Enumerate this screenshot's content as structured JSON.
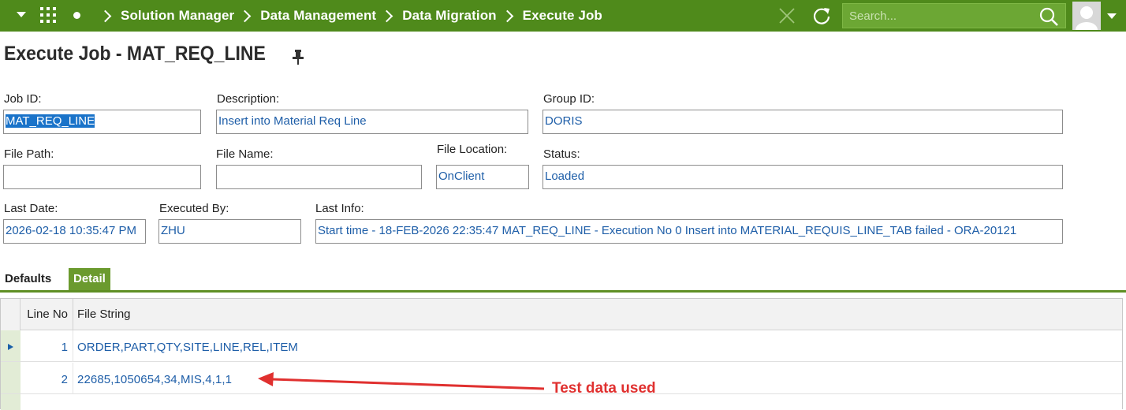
{
  "nav": {
    "breadcrumbs": [
      "Solution Manager",
      "Data Management",
      "Data Migration",
      "Execute Job"
    ],
    "search_placeholder": "Search...",
    "accent_color": "#4f8a1b"
  },
  "page": {
    "title": "Execute Job - MAT_REQ_LINE"
  },
  "form": {
    "job_id": {
      "label": "Job ID:",
      "value": "MAT_REQ_LINE"
    },
    "description": {
      "label": "Description:",
      "value": "Insert into Material Req Line"
    },
    "group_id": {
      "label": "Group ID:",
      "value": "DORIS"
    },
    "file_path": {
      "label": "File Path:",
      "value": ""
    },
    "file_name": {
      "label": "File Name:",
      "value": ""
    },
    "file_location": {
      "label": "File Location:",
      "value": "OnClient"
    },
    "status": {
      "label": "Status:",
      "value": "Loaded"
    },
    "last_date": {
      "label": "Last Date:",
      "value": "2026-02-18 10:35:47 PM"
    },
    "executed_by": {
      "label": "Executed By:",
      "value": "ZHU"
    },
    "last_info": {
      "label": "Last Info:",
      "value": "Start time - 18-FEB-2026 22:35:47   MAT_REQ_LINE - Execution No 0 Insert into MATERIAL_REQUIS_LINE_TAB failed - ORA-20121"
    }
  },
  "tabs": [
    {
      "label": "Defaults",
      "active": false
    },
    {
      "label": "Detail",
      "active": true
    }
  ],
  "table": {
    "columns": [
      "Line No",
      "File String"
    ],
    "rows": [
      {
        "line_no": "1",
        "file_string": "ORDER,PART,QTY,SITE,LINE,REL,ITEM"
      },
      {
        "line_no": "2",
        "file_string": "22685,1050654,34,MIS,4,1,1"
      }
    ]
  },
  "annotation": {
    "text": "Test data used",
    "color": "#e0302f"
  }
}
